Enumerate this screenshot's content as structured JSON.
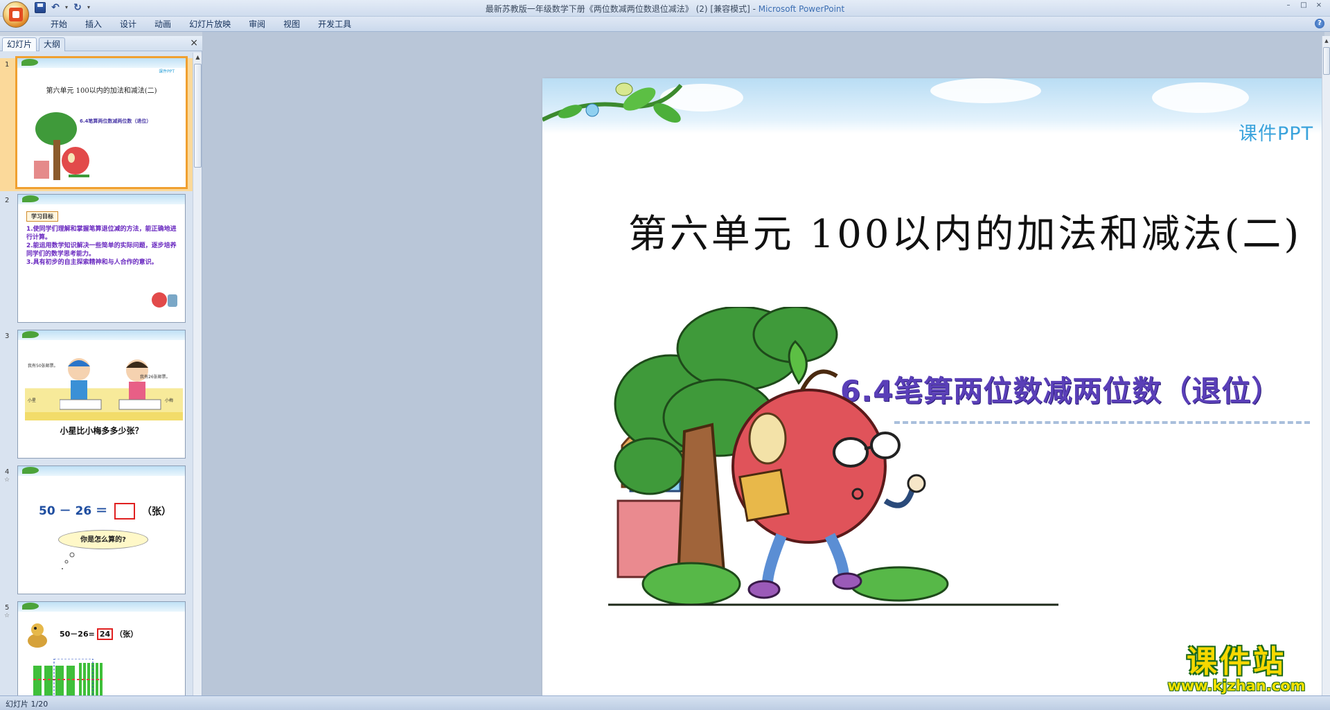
{
  "window": {
    "title": "最新苏教版一年级数学下册《两位数减两位数退位减法》 (2) [兼容模式] - ",
    "app_name": "Microsoft PowerPoint",
    "controls": [
      "–",
      "□",
      "×"
    ]
  },
  "ribbon": {
    "tabs": [
      "开始",
      "插入",
      "设计",
      "动画",
      "幻灯片放映",
      "审阅",
      "视图",
      "开发工具"
    ]
  },
  "panel": {
    "tabs": [
      "幻灯片",
      "大纲"
    ],
    "close": "×"
  },
  "thumbnails": [
    {
      "num": "1",
      "tag": "课件PPT",
      "title": "第六单元 100以内的加法和减法(二)",
      "subtitle": "6.4笔算两位数减两位数（退位）"
    },
    {
      "num": "2",
      "heading": "学习目标",
      "lines": [
        "1.使同学们理解和掌握笔算退位减的方法，能正确地进行计算。",
        "2.能运用数学知识解决一些简单的实际问题，逐步培养同学们的数学思考能力。",
        "3.具有初步的自主探索精神和与人合作的意识。"
      ]
    },
    {
      "num": "3",
      "bubble_left": "我有50张邮票。",
      "bubble_right": "我有26张邮票。",
      "label_left": "小星",
      "label_right": "小梅",
      "caption": "小星比小梅多多少张？"
    },
    {
      "num": "4",
      "star": "☆",
      "a": "50",
      "op": "－",
      "b": "26",
      "eq": "＝",
      "unit": "（张）",
      "cloud": "你是怎么算的?"
    },
    {
      "num": "5",
      "star": "☆",
      "eq": "50－26=",
      "answer": "24",
      "unit": "（张）"
    }
  ],
  "slide": {
    "course_tag": "课件PPT",
    "title": "第六单元  100以内的加法和减法(二)",
    "subtitle": "6.4笔算两位数减两位数（退位）"
  },
  "watermark": {
    "text": "课件站",
    "url": "www.kjzhan.com"
  },
  "status": {
    "slide_info": "幻灯片 1/20"
  },
  "colors": {
    "subtitle": "#5a3fb8",
    "course_tag": "#3aa3dc",
    "selection": "#f0a030"
  }
}
